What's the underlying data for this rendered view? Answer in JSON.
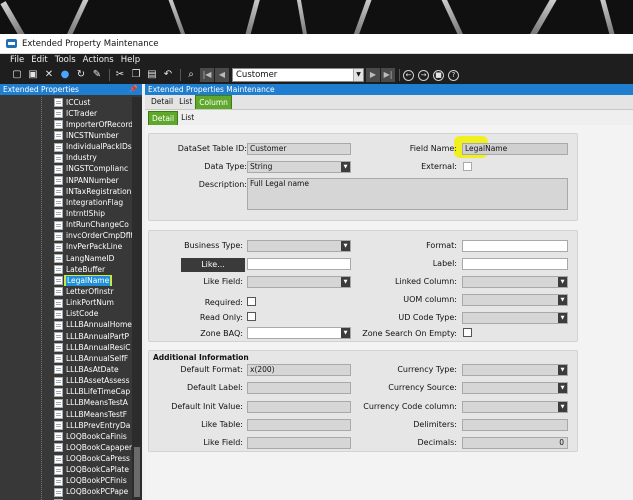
{
  "window": {
    "title": "Extended Property Maintenance"
  },
  "menu": [
    "File",
    "Edit",
    "Tools",
    "Actions",
    "Help"
  ],
  "toolbar": {
    "combo_value": "Customer"
  },
  "left_panel": {
    "header": "Extended Properties",
    "items": [
      "ICCust",
      "ICTrader",
      "ImporterOfRecord",
      "INCSTNumber",
      "IndividualPackIDs",
      "Industry",
      "INGSTComplianc",
      "INPANNumber",
      "INTaxRegistrationI",
      "IntegrationFlag",
      "IntrntlShip",
      "IntRunChangeCo",
      "invcOrderCmpDflt",
      "InvPerPackLine",
      "LangNameID",
      "LateBuffer",
      "LegalName",
      "LetterOfInstr",
      "LinkPortNum",
      "ListCode",
      "LLLBAnnualHome",
      "LLLBAnnualPartP",
      "LLLBAnnualResiC",
      "LLLBAnnualSelfF",
      "LLLBAsAtDate",
      "LLLBAssetAssess",
      "LLLBLifeTimeCap",
      "LLLBMeansTestA",
      "LLLBMeansTestF",
      "LLLBPrevEntryDa",
      "LOQBookCaFinis",
      "LOQBookCapaper",
      "LOQBookCaPress",
      "LOQBookCaPlate",
      "LOQBookPCFinis",
      "LOQBookPCPape",
      "LOQBookPCPlate",
      "LOQBookPCPres"
    ],
    "selected_index": 16
  },
  "right_panel": {
    "header": "Extended Properties Maintenance",
    "tabs_top": [
      "Detail",
      "List",
      "Column"
    ],
    "tabs_sub": [
      "Detail",
      "List"
    ],
    "top_group": {
      "dataset_label": "DataSet Table ID:",
      "dataset_value": "Customer",
      "datatype_label": "Data Type:",
      "datatype_value": "String",
      "description_label": "Description:",
      "description_value": "Full Legal name",
      "fieldname_label": "Field Name:",
      "fieldname_value": "LegalName",
      "external_label": "External:"
    },
    "mid_group": {
      "business_type_label": "Business Type:",
      "like_button": "Like...",
      "like_field_label": "Like Field:",
      "required_label": "Required:",
      "read_only_label": "Read Only:",
      "zone_baq_label": "Zone BAQ:",
      "format_label": "Format:",
      "label_label": "Label:",
      "linked_column_label": "Linked Column:",
      "uom_column_label": "UOM column:",
      "ud_code_type_label": "UD Code Type:",
      "zone_search_label": "Zone Search On Empty:"
    },
    "additional": {
      "title": "Additional Information",
      "default_format_label": "Default Format:",
      "default_format_value": "x(200)",
      "default_label_label": "Default Label:",
      "default_init_label": "Default Init Value:",
      "like_table_label": "Like Table:",
      "like_field_label": "Like Field:",
      "currency_type_label": "Currency Type:",
      "currency_source_label": "Currency Source:",
      "currency_code_label": "Currency Code column:",
      "delimiters_label": "Delimiters:",
      "decimals_label": "Decimals:",
      "decimals_value": "0"
    }
  }
}
